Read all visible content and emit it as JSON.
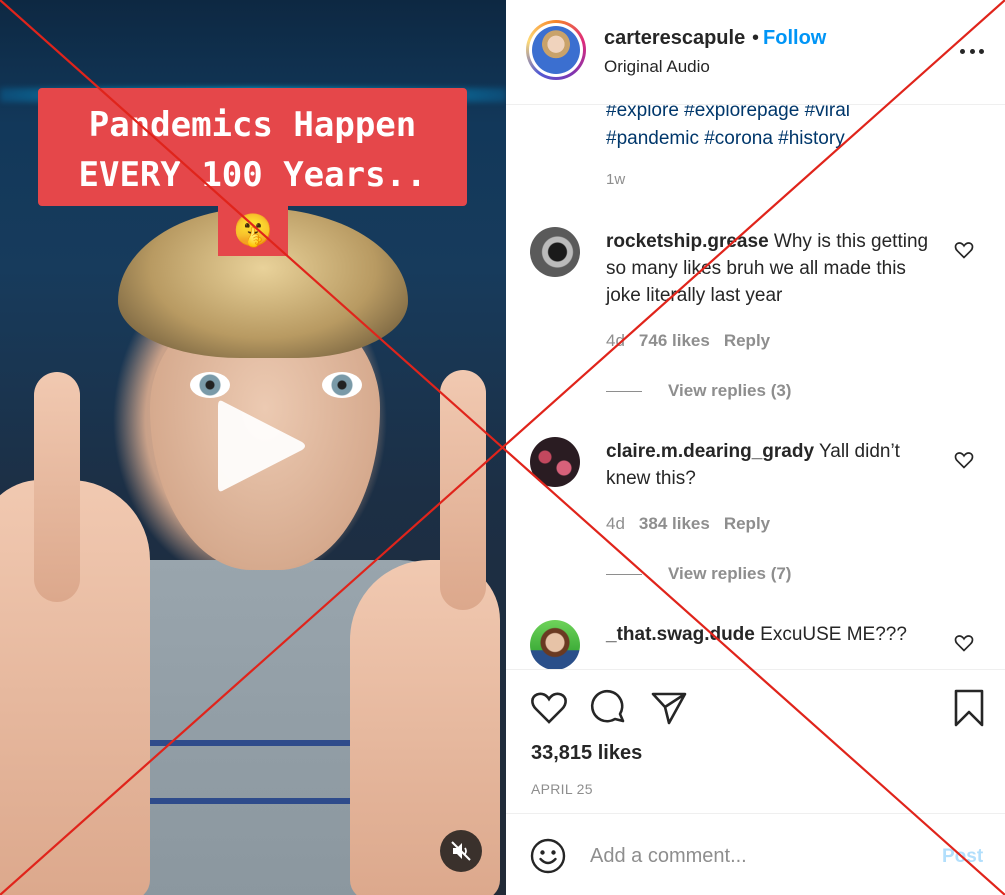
{
  "video": {
    "caption_line1": "Pandemics Happen",
    "caption_line2": "EVERY 100 Years..",
    "caption_emoji": "🤫",
    "play_icon": "play-icon",
    "mute_icon": "speaker-muted-icon"
  },
  "header": {
    "username": "carterescapule",
    "separator": "•",
    "follow_label": "Follow",
    "audio_label": "Original Audio",
    "more_icon": "more-horizontal-icon"
  },
  "caption": {
    "tags_line1": "#explore #explorepage #viral",
    "tags_line2": "#pandemic #corona #history",
    "time": "1w"
  },
  "comments": [
    {
      "username": "rocketship.grease",
      "text": "Why is this getting so many likes bruh we all made this joke literally last year",
      "time": "4d",
      "likes": "746 likes",
      "reply_label": "Reply",
      "view_replies": "View replies (3)"
    },
    {
      "username": "claire.m.dearing_grady",
      "text": "Yall didn’t knew this?",
      "time": "4d",
      "likes": "384 likes",
      "reply_label": "Reply",
      "view_replies": "View replies (7)"
    },
    {
      "username": "_that.swag.dude",
      "text": "ExcuUSE ME???"
    }
  ],
  "actions": {
    "like_icon": "heart-icon",
    "comment_icon": "comment-icon",
    "share_icon": "paper-plane-icon",
    "save_icon": "bookmark-icon",
    "likes_count": "33,815 likes",
    "date": "APRIL 25"
  },
  "composer": {
    "emoji_icon": "smiley-icon",
    "placeholder": "Add a comment...",
    "post_label": "Post"
  },
  "colors": {
    "link_blue": "#0095f6",
    "hashtag_blue": "#00376b",
    "muted_text": "#8e8e8e",
    "caption_red": "#e5474a",
    "overlay_red": "#e0241b"
  }
}
